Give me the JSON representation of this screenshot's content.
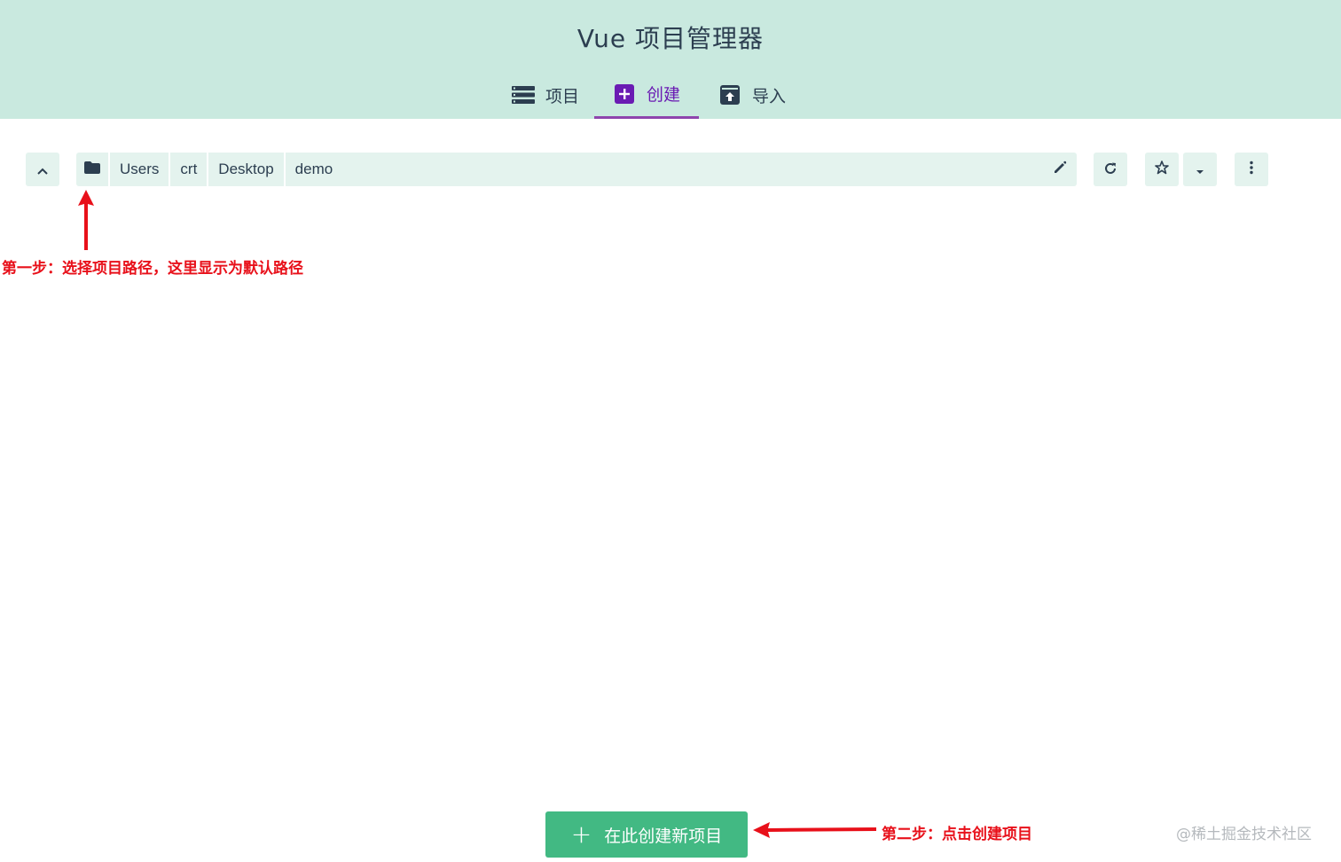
{
  "header": {
    "title": "Vue 项目管理器",
    "tabs": [
      {
        "label": "项目",
        "icon": "list-icon",
        "active": false
      },
      {
        "label": "创建",
        "icon": "plus-square-icon",
        "active": true
      },
      {
        "label": "导入",
        "icon": "import-icon",
        "active": false
      }
    ]
  },
  "pathbar": {
    "segments": [
      "Users",
      "crt",
      "Desktop",
      "demo"
    ]
  },
  "annotations": {
    "step1": "第一步：选择项目路径，这里显示为默认路径",
    "step2": "第二步：点击创建项目"
  },
  "create_button": {
    "label": "在此创建新项目"
  },
  "watermark": "@稀土掘金技术社区",
  "colors": {
    "header_bg": "#c9e9df",
    "accent_purple": "#8e44ad",
    "button_green": "#42b983",
    "annotation_red": "#e8101a"
  }
}
